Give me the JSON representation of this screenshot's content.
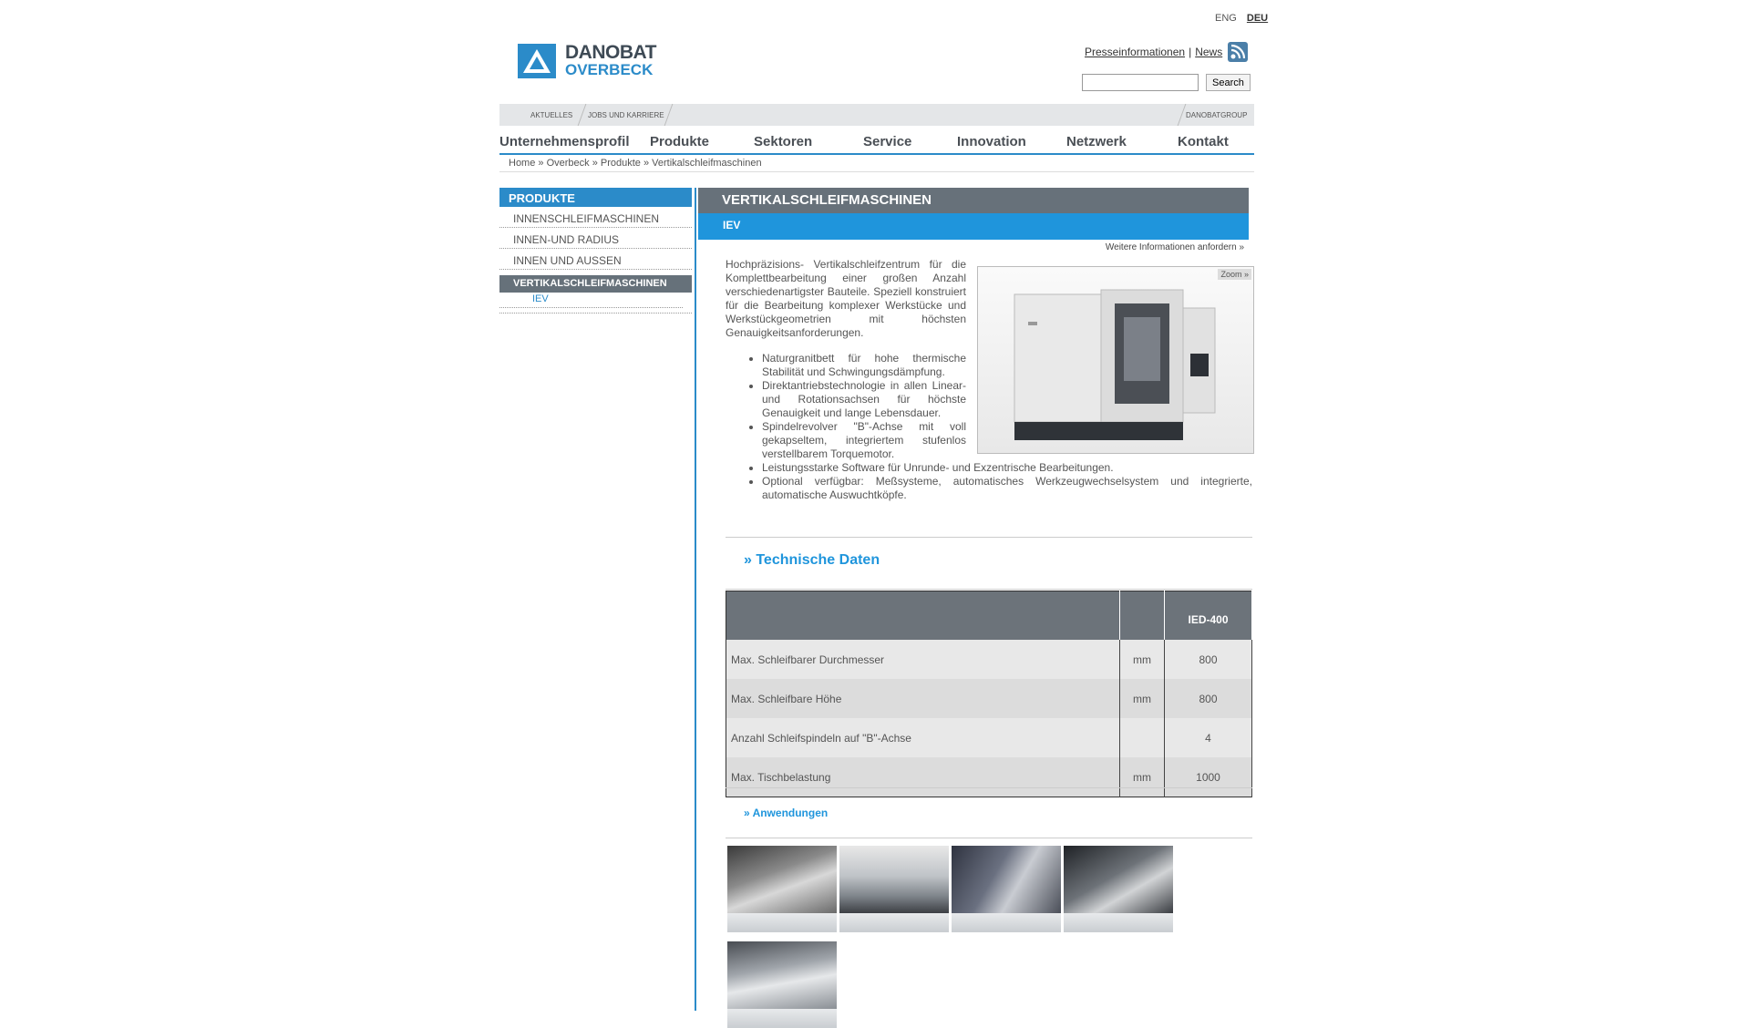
{
  "lang": {
    "eng": "ENG",
    "deu": "DEU"
  },
  "logo": {
    "line1": "DANOBAT",
    "line2": "OVERBECK"
  },
  "toplinks": {
    "press": "Presseinformationen",
    "sep": "|",
    "news": "News"
  },
  "search": {
    "button": "Search",
    "value": ""
  },
  "subnav": {
    "items": [
      "AKTUELLES",
      "JOBS UND KARRIERE"
    ],
    "right": "DANOBATGROUP"
  },
  "mainnav": {
    "items": [
      "Unternehmensprofil",
      "Produkte",
      "Sektoren",
      "Service",
      "Innovation",
      "Netzwerk",
      "Kontakt"
    ]
  },
  "breadcrumb": "Home » Overbeck » Produkte » Vertikalschleifmaschinen",
  "sidebar": {
    "title": "PRODUKTE",
    "items": [
      "INNENSCHLEIFMASCHINEN",
      "INNEN-UND RADIUS",
      "INNEN UND AUSSEN"
    ],
    "active": "VERTIKALSCHLEIFMASCHINEN",
    "sub": "IEV"
  },
  "content": {
    "title": "VERTIKALSCHLEIFMASCHINEN",
    "subtitle": "IEV",
    "more": "Weitere Informationen anfordern »",
    "zoom": "Zoom »",
    "intro": "Hochpräzisions- Vertikalschleifzentrum für die Komplettbearbeitung einer großen Anzahl verschiedenartigster Bauteile. Speziell konstruiert für die Bearbeitung komplexer Werkstücke und Werkstückgeometrien mit höchsten Genauigkeitsanforderungen.",
    "bullets": [
      "Naturgranitbett für hohe thermische Stabilität und Schwingungsdämpfung.",
      "Direktantriebstechnologie in allen Linear- und Rotationsachsen für höchste Genauigkeit und lange Lebensdauer.",
      "Spindelrevolver \"B\"-Achse mit voll gekapseltem, integriertem stufenlos verstellbarem Torquemotor.",
      "Leistungsstarke Software für Unrunde- und Exzentrische Bearbeitungen.",
      "Optional verfügbar: Meßsysteme, automatisches Werkzeugwechselsystem und integrierte, automatische Auswuchtköpfe."
    ],
    "tech_title": "» Technische Daten",
    "table": {
      "model": "IED-400",
      "rows": [
        {
          "label": "Max. Schleifbarer Durchmesser",
          "unit": "mm",
          "value": "800"
        },
        {
          "label": "Max. Schleifbare Höhe",
          "unit": "mm",
          "value": "800"
        },
        {
          "label": "Anzahl Schleifspindeln auf \"B\"-Achse",
          "unit": "",
          "value": "4"
        },
        {
          "label": "Max. Tischbelastung",
          "unit": "mm",
          "value": "1000"
        }
      ]
    },
    "anwendungen": "» Anwendungen"
  }
}
